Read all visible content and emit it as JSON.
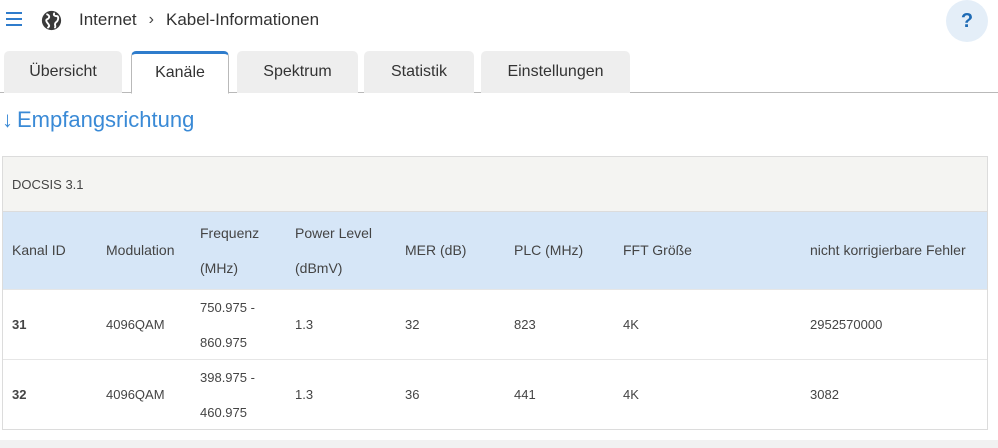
{
  "header": {
    "menu_icon": "hamburger-menu-icon",
    "globe_icon": "globe-icon",
    "breadcrumb": [
      "Internet",
      "Kabel-Informationen"
    ],
    "separator": "›",
    "help": "?"
  },
  "tabs": [
    {
      "label": "Übersicht",
      "active": false
    },
    {
      "label": "Kanäle",
      "active": true
    },
    {
      "label": "Spektrum",
      "active": false
    },
    {
      "label": "Statistik",
      "active": false
    },
    {
      "label": "Einstellungen",
      "active": false
    }
  ],
  "section": {
    "arrow": "↓",
    "title": "Empfangsrichtung"
  },
  "table": {
    "group_title": "DOCSIS 3.1",
    "columns": [
      {
        "line1": "Kanal ID",
        "line2": ""
      },
      {
        "line1": "Modulation",
        "line2": ""
      },
      {
        "line1": "Frequenz",
        "line2": "(MHz)"
      },
      {
        "line1": "Power Level",
        "line2": "(dBmV)"
      },
      {
        "line1": "MER (dB)",
        "line2": ""
      },
      {
        "line1": "PLC (MHz)",
        "line2": ""
      },
      {
        "line1": "FFT Größe",
        "line2": ""
      },
      {
        "line1": "nicht korrigierbare Fehler",
        "line2": ""
      }
    ],
    "rows": [
      {
        "kanal_id": "31",
        "modulation": "4096QAM",
        "freq1": "750.975 -",
        "freq2": "860.975",
        "power": "1.3",
        "mer": "32",
        "plc": "823",
        "fft": "4K",
        "fehler": "2952570000"
      },
      {
        "kanal_id": "32",
        "modulation": "4096QAM",
        "freq1": "398.975 -",
        "freq2": "460.975",
        "power": "1.3",
        "mer": "36",
        "plc": "441",
        "fft": "4K",
        "fehler": "3082"
      }
    ]
  },
  "colors": {
    "accent": "#2f7ccc",
    "header_row_bg": "#d6e6f7",
    "title": "#3a8ad6"
  }
}
